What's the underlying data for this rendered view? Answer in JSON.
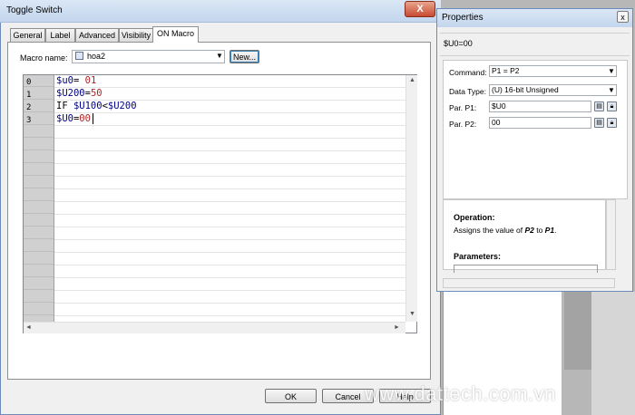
{
  "main_window": {
    "title": "Toggle Switch",
    "close_glyph": "X",
    "tabs": [
      "General",
      "Label",
      "Advanced",
      "Visibility",
      "ON Macro"
    ],
    "active_tab": "ON Macro",
    "macro_label": "Macro name:",
    "macro_value": "hoa2",
    "new_button": "New...",
    "rows": [
      {
        "num": "0",
        "code": [
          {
            "t": "$u0",
            "c": "var"
          },
          {
            "t": "= ",
            "c": "kw"
          },
          {
            "t": "01",
            "c": "num"
          }
        ]
      },
      {
        "num": "1",
        "code": [
          {
            "t": "$U200",
            "c": "var"
          },
          {
            "t": "=",
            "c": "kw"
          },
          {
            "t": "50",
            "c": "num"
          }
        ]
      },
      {
        "num": "2",
        "code": [
          {
            "t": "IF ",
            "c": "kw"
          },
          {
            "t": "$U100",
            "c": "var"
          },
          {
            "t": "<",
            "c": "kw"
          },
          {
            "t": "$U200",
            "c": "var"
          }
        ]
      },
      {
        "num": "3",
        "code": [
          {
            "t": "$U0",
            "c": "var"
          },
          {
            "t": "=",
            "c": "kw"
          },
          {
            "t": "00",
            "c": "num"
          }
        ]
      }
    ],
    "ok_button": "OK",
    "cancel_button": "Cancel",
    "help_button": "Help"
  },
  "properties": {
    "title": "Properties",
    "close_glyph": "x",
    "expression": "$U0=00",
    "command_label": "Command:",
    "command_value": "P1 = P2",
    "datatype_label": "Data Type:",
    "datatype_value": "(U) 16-bit Unsigned",
    "par1_label": "Par. P1:",
    "par1_value": "$U0",
    "par2_label": "Par. P2:",
    "par2_value": "00",
    "help_operation_title": "Operation:",
    "help_operation_text": "Assigns the value of P2 to P1.",
    "help_parameters_title": "Parameters:"
  },
  "watermark": "www.dattech.com.vn",
  "colors": {
    "variable": "#00008b",
    "number": "#b22222",
    "title_bar": "#c3d6ee"
  }
}
